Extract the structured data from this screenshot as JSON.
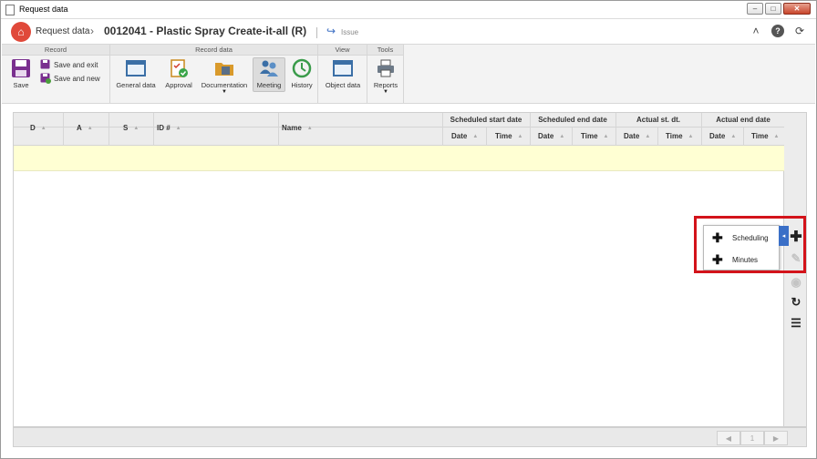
{
  "window": {
    "title": "Request data"
  },
  "header": {
    "breadcrumb": "Request data",
    "record_title": "0012041 - Plastic Spray Create-it-all (R)",
    "issue_label": "Issue"
  },
  "ribbon": {
    "groups": [
      {
        "title": "Record"
      },
      {
        "title": "Record data"
      },
      {
        "title": "View"
      },
      {
        "title": "Tools"
      }
    ],
    "save_label": "Save",
    "save_exit_label": "Save and exit",
    "save_new_label": "Save and new",
    "general_data_label": "General data",
    "approval_label": "Approval",
    "documentation_label": "Documentation",
    "meeting_label": "Meeting",
    "history_label": "History",
    "object_data_label": "Object data",
    "reports_label": "Reports"
  },
  "grid": {
    "columns": [
      "D",
      "A",
      "S",
      "ID #",
      "Name"
    ],
    "groups": [
      "Scheduled start date",
      "Scheduled end date",
      "Actual st. dt.",
      "Actual end date"
    ],
    "sub_columns": [
      "Date",
      "Time",
      "Date",
      "Time",
      "Date",
      "Time",
      "Date",
      "Time"
    ]
  },
  "add_menu": {
    "items": [
      {
        "label": "Scheduling"
      },
      {
        "label": "Minutes"
      }
    ]
  },
  "pager": {
    "page": "1"
  },
  "colors": {
    "accent": "#3a6fc7",
    "highlight": "#d3131a",
    "row_selected": "#ffffd3",
    "logo": "#e0493a"
  }
}
